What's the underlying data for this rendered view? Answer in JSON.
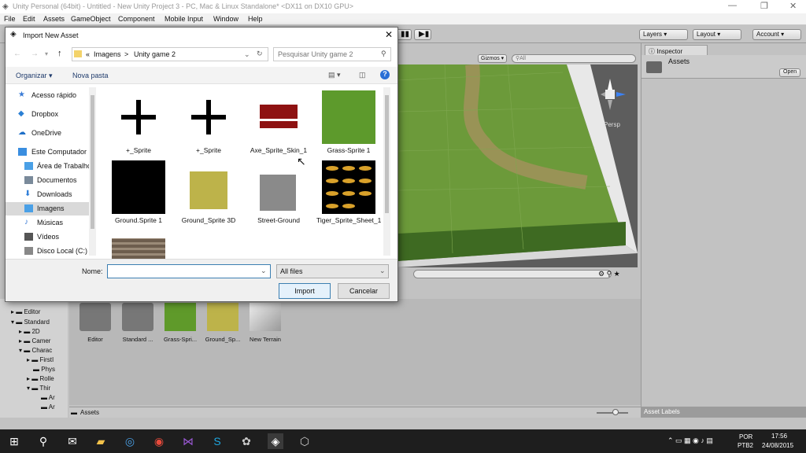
{
  "window": {
    "title": "Unity Personal (64bit) - Untitled - New Unity Project 3 - PC, Mac & Linux Standalone* <DX11 on DX10 GPU>",
    "minimize": "—",
    "maximize": "❐",
    "close": "✕"
  },
  "menu": [
    "File",
    "Edit",
    "Assets",
    "GameObject",
    "Component",
    "Mobile Input",
    "Window",
    "Help"
  ],
  "toolbar": {
    "layers": "Layers",
    "layout": "Layout",
    "account": "Account"
  },
  "scene": {
    "gizmos": "Gizmos",
    "search_placeholder": "All",
    "persp": "Persp"
  },
  "inspector": {
    "tab": "Inspector",
    "asset_title": "Assets",
    "open_button": "Open",
    "asset_labels": "Asset Labels"
  },
  "project": {
    "tree": [
      {
        "label": "Editor",
        "indent": 1
      },
      {
        "label": "Standard",
        "indent": 1
      },
      {
        "label": "2D",
        "indent": 2
      },
      {
        "label": "Camer",
        "indent": 2
      },
      {
        "label": "Charac",
        "indent": 2
      },
      {
        "label": "FirstI",
        "indent": 3
      },
      {
        "label": "Phys",
        "indent": 3
      },
      {
        "label": "Rolle",
        "indent": 3
      },
      {
        "label": "Thir",
        "indent": 3
      },
      {
        "label": "Ar",
        "indent": 4
      },
      {
        "label": "Ar",
        "indent": 4
      }
    ],
    "assets": [
      {
        "label": "Editor",
        "kind": "folder"
      },
      {
        "label": "Standard ...",
        "kind": "folder"
      },
      {
        "label": "Grass-Spri...",
        "kind": "grass"
      },
      {
        "label": "Ground_Sp...",
        "kind": "olive"
      },
      {
        "label": "New Terrain",
        "kind": "terrain"
      }
    ],
    "footer": "Assets"
  },
  "dialog": {
    "title": "Import New Asset",
    "breadcrumb": [
      "«",
      "Imagens",
      ">",
      "Unity game 2"
    ],
    "search_placeholder": "Pesquisar Unity game 2",
    "organize": "Organizar ▾",
    "new_folder": "Nova pasta",
    "nav": [
      {
        "label": "Acesso rápido",
        "icon": "star-icon",
        "color": "#3a7bd5"
      },
      {
        "label": "Dropbox",
        "icon": "dropbox-icon",
        "color": "#2a7fd4"
      },
      {
        "label": "OneDrive",
        "icon": "onedrive-icon",
        "color": "#1e6fc8"
      },
      {
        "label": "Este Computador",
        "icon": "computer-icon",
        "color": "#3a8ee0"
      },
      {
        "label": "Área de Trabalho",
        "icon": "desktop-icon",
        "color": "#4aa0e6"
      },
      {
        "label": "Documentos",
        "icon": "documents-icon",
        "color": "#7a8a9a"
      },
      {
        "label": "Downloads",
        "icon": "downloads-icon",
        "color": "#2f7ed8"
      },
      {
        "label": "Imagens",
        "icon": "pictures-icon",
        "color": "#4aa0e6",
        "selected": true
      },
      {
        "label": "Músicas",
        "icon": "music-icon",
        "color": "#3a7bd5"
      },
      {
        "label": "Vídeos",
        "icon": "videos-icon",
        "color": "#555"
      },
      {
        "label": "Disco Local (C:)",
        "icon": "disk-icon",
        "color": "#888"
      }
    ],
    "files": [
      {
        "label": "+_Sprite",
        "kind": "plus"
      },
      {
        "label": "+_Sprite",
        "kind": "plus"
      },
      {
        "label": "Axe_Sprite_Skin_1",
        "kind": "axe"
      },
      {
        "label": "Grass-Sprite 1",
        "kind": "grass"
      },
      {
        "label": "Ground.Sprite 1",
        "kind": "black"
      },
      {
        "label": "Ground_Sprite 3D",
        "kind": "olive"
      },
      {
        "label": "Street-Ground",
        "kind": "gray"
      },
      {
        "label": "Tiger_Sprite_Sheet_1",
        "kind": "tiger"
      },
      {
        "label": "",
        "kind": "wood"
      }
    ],
    "name_label": "Nome:",
    "name_value": "",
    "filetype": "All files",
    "import_button": "Import",
    "cancel_button": "Cancelar"
  },
  "taskbar": {
    "lang": "POR",
    "layout": "PTB2",
    "time": "17:56",
    "date": "24/08/2015"
  }
}
